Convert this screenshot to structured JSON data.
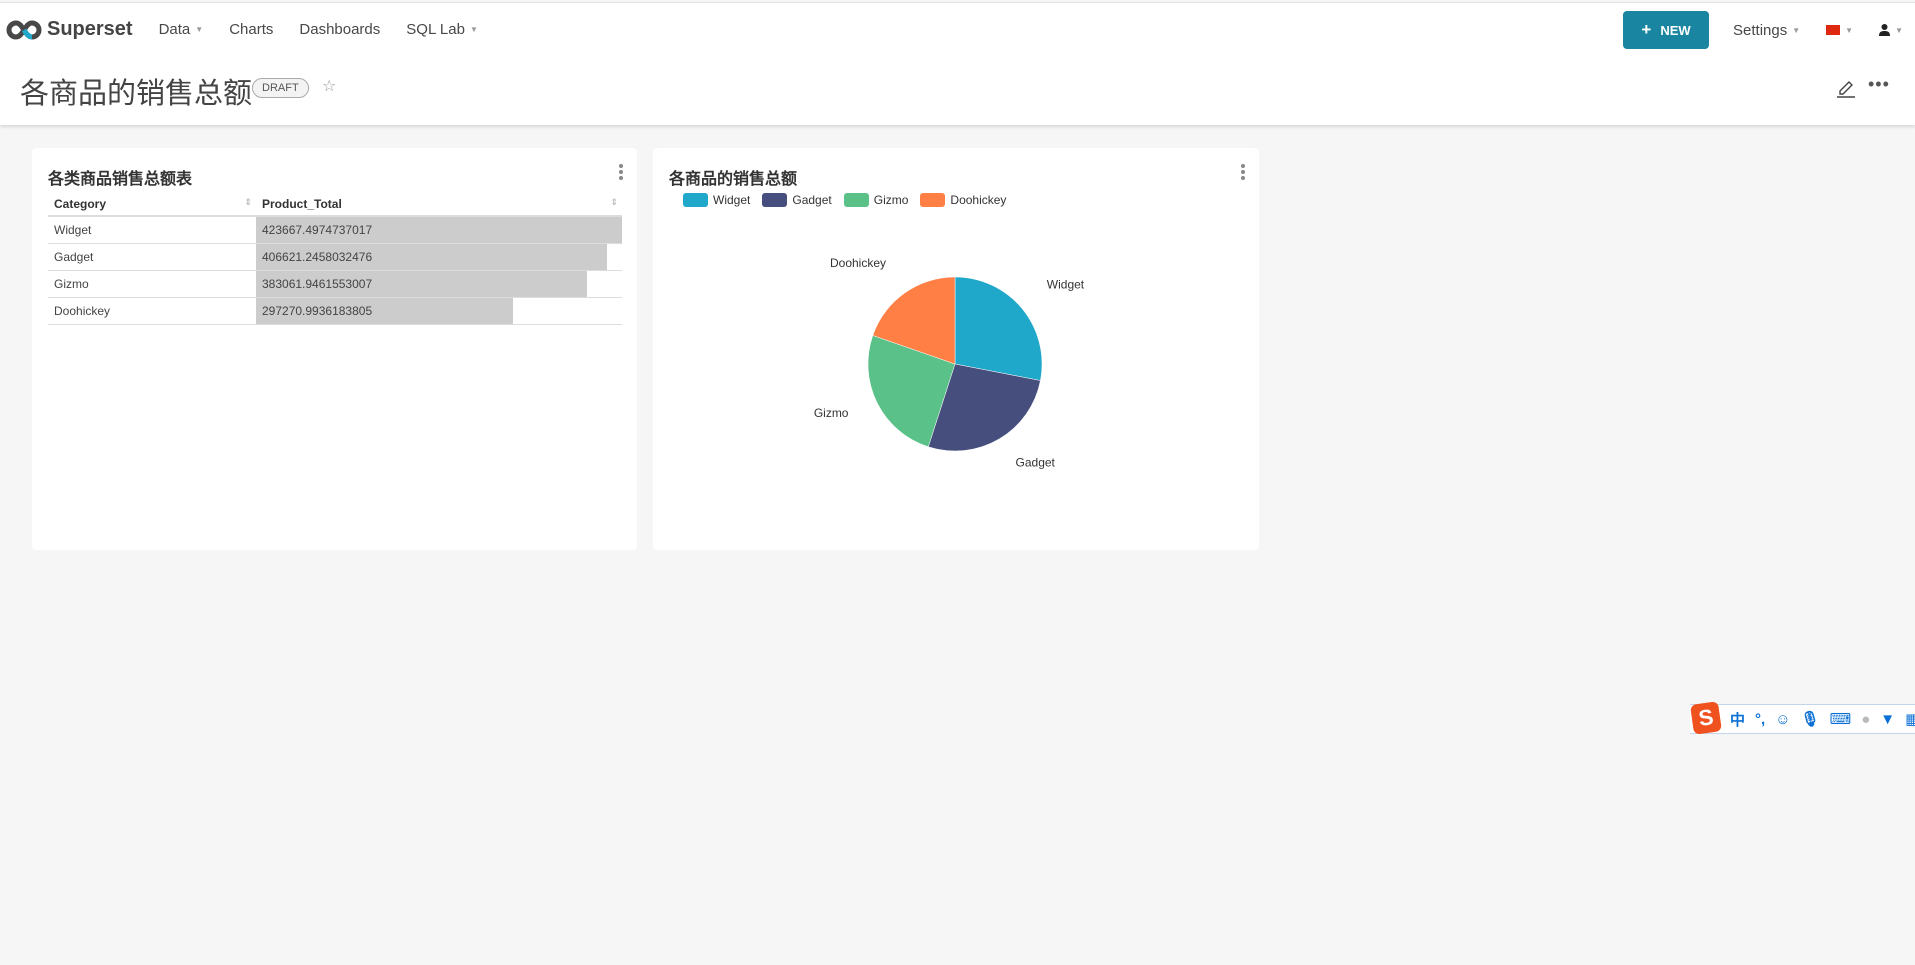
{
  "nav": {
    "brand": "Superset",
    "items": [
      {
        "label": "Data",
        "dropdown": true
      },
      {
        "label": "Charts"
      },
      {
        "label": "Dashboards"
      },
      {
        "label": "SQL Lab",
        "dropdown": true
      }
    ],
    "new_label": "NEW",
    "settings_label": "Settings",
    "accent": "#1a85a0"
  },
  "header": {
    "title": "各商品的销售总额",
    "badge": "DRAFT"
  },
  "table_card": {
    "title": "各类商品销售总额表",
    "columns": [
      "Category",
      "Product_Total"
    ],
    "rows": [
      [
        "Widget",
        "423667.4974737017"
      ],
      [
        "Gadget",
        "406621.2458032476"
      ],
      [
        "Gizmo",
        "383061.9461553007"
      ],
      [
        "Doohickey",
        "297270.9936183805"
      ]
    ]
  },
  "chart_data": {
    "type": "pie",
    "title": "各商品的销售总额",
    "categories": [
      "Widget",
      "Gadget",
      "Gizmo",
      "Doohickey"
    ],
    "values": [
      423667.4974737017,
      406621.2458032476,
      383061.9461553007,
      297270.9936183805
    ],
    "colors": [
      "#1fa8c9",
      "#454e7c",
      "#5ac189",
      "#ff7f44"
    ],
    "legend": "top-left"
  },
  "ime": {
    "items": [
      "中",
      "°,"
    ]
  }
}
